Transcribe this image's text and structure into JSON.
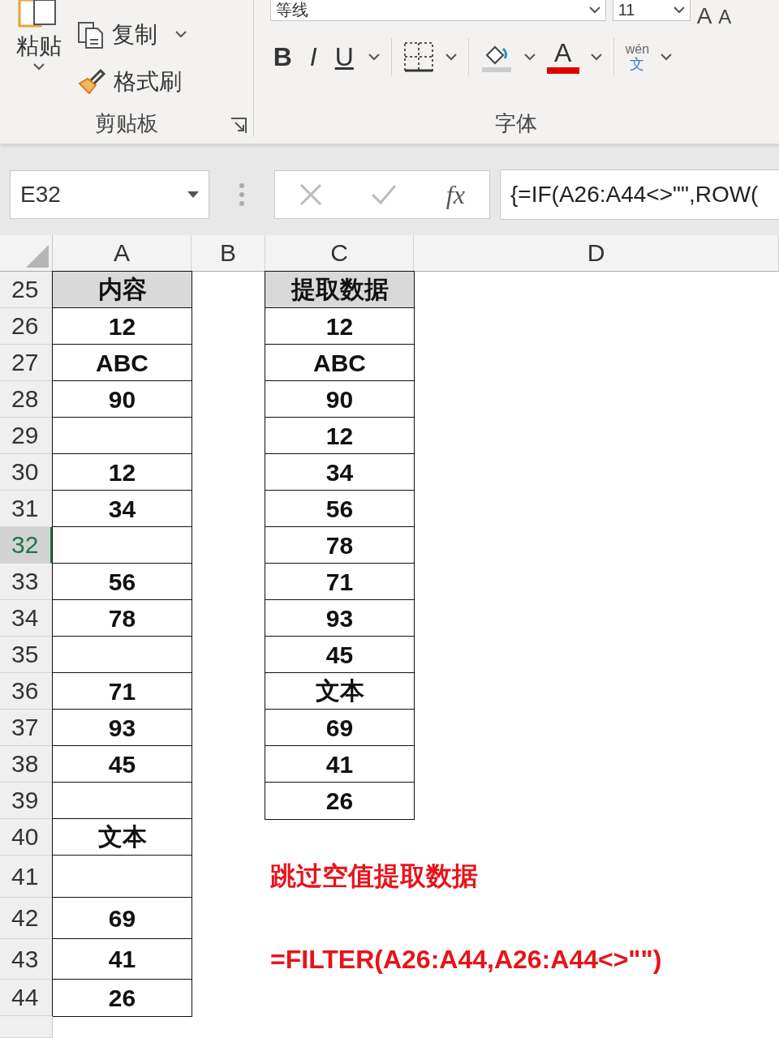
{
  "ribbon": {
    "clipboard": {
      "paste": "粘贴",
      "copy": "复制",
      "format_painter": "格式刷",
      "label": "剪贴板"
    },
    "font": {
      "font_name": "等线",
      "font_size": "11",
      "grow": "A",
      "shrink": "A",
      "bold": "B",
      "italic": "I",
      "underline": "U",
      "font_color": "A",
      "phonetic_top": "wén",
      "phonetic_bottom": "文",
      "label": "字体"
    }
  },
  "formula_bar": {
    "name_box": "E32",
    "fx": "fx",
    "formula": "{=IF(A26:A44<>\"\",ROW("
  },
  "columns": [
    {
      "label": "A"
    },
    {
      "label": "B"
    },
    {
      "label": "C"
    },
    {
      "label": "D"
    }
  ],
  "rows": [
    {
      "number": "25",
      "selected": false,
      "kind": "header",
      "a": "内容",
      "c": "提取数据"
    },
    {
      "number": "26",
      "selected": false,
      "a": "12",
      "c": "12"
    },
    {
      "number": "27",
      "selected": false,
      "a": "ABC",
      "c": "ABC"
    },
    {
      "number": "28",
      "selected": false,
      "a": "90",
      "c": "90"
    },
    {
      "number": "29",
      "selected": false,
      "c": "12"
    },
    {
      "number": "30",
      "selected": false,
      "a": "12",
      "c": "34"
    },
    {
      "number": "31",
      "selected": false,
      "a": "34",
      "c": "56"
    },
    {
      "number": "32",
      "selected": true,
      "c": "78"
    },
    {
      "number": "33",
      "selected": false,
      "a": "56",
      "c": "71"
    },
    {
      "number": "34",
      "selected": false,
      "a": "78",
      "c": "93"
    },
    {
      "number": "35",
      "selected": false,
      "c": "45"
    },
    {
      "number": "36",
      "selected": false,
      "a": "71",
      "c": "文本"
    },
    {
      "number": "37",
      "selected": false,
      "a": "93",
      "c": "69"
    },
    {
      "number": "38",
      "selected": false,
      "a": "45",
      "c": "41"
    },
    {
      "number": "39",
      "selected": false,
      "c": "26"
    },
    {
      "number": "40",
      "selected": false,
      "a": "文本"
    },
    {
      "number": "41",
      "selected": false,
      "note": "跳过空值提取数据"
    },
    {
      "number": "42",
      "selected": false,
      "a": "69"
    },
    {
      "number": "43",
      "selected": false,
      "a": "41",
      "note": "=FILTER(A26:A44,A26:A44<>\"\")"
    },
    {
      "number": "44",
      "selected": false,
      "a": "26"
    }
  ]
}
